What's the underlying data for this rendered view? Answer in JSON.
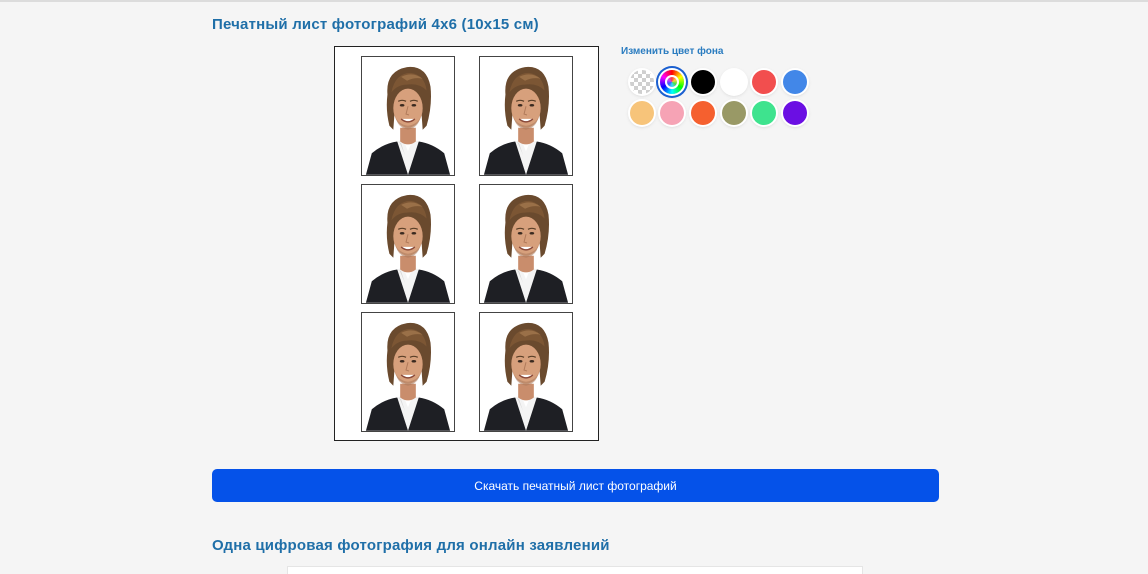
{
  "print_sheet": {
    "title": "Печатный лист фотографий 4x6 (10x15 см)",
    "photo_count": 6
  },
  "background_palette": {
    "label": "Изменить цвет фона",
    "swatches": [
      {
        "name": "transparent",
        "color": "transparent"
      },
      {
        "name": "custom-color",
        "color": "rainbow",
        "selected": true
      },
      {
        "name": "black",
        "color": "#000000"
      },
      {
        "name": "white",
        "color": "#ffffff"
      },
      {
        "name": "red",
        "color": "#f24e4e"
      },
      {
        "name": "blue",
        "color": "#4287e8"
      },
      {
        "name": "peach",
        "color": "#f7c47a"
      },
      {
        "name": "pink",
        "color": "#f6a3b5"
      },
      {
        "name": "orange",
        "color": "#f5602f"
      },
      {
        "name": "olive",
        "color": "#999966"
      },
      {
        "name": "mint",
        "color": "#3ee38e"
      },
      {
        "name": "purple",
        "color": "#6b0fe3"
      }
    ]
  },
  "download_button": {
    "label": "Скачать печатный лист фотографий"
  },
  "digital_photo": {
    "title": "Одна цифровая фотография для онлайн заявлений"
  },
  "colors": {
    "accent_blue": "#0552e9",
    "title_blue": "#1f6fa8",
    "page_background": "#f5f5f5"
  }
}
